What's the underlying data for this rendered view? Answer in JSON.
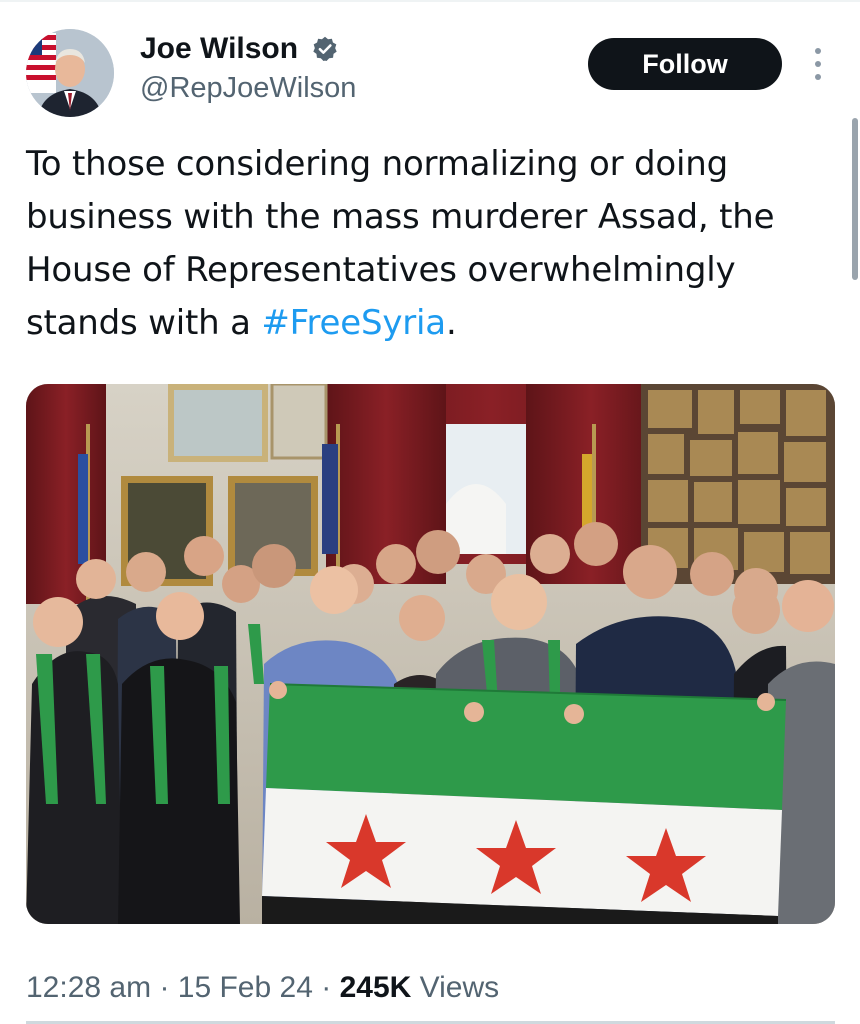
{
  "author": {
    "display_name": "Joe Wilson",
    "handle": "@RepJoeWilson",
    "verified_icon": "verified-badge-icon",
    "verified_color": "#536471"
  },
  "actions": {
    "follow_label": "Follow",
    "more_icon": "more-vertical-icon"
  },
  "tweet": {
    "text_before": "To those considering normalizing or doing business with the mass murderer Assad, the House of Representatives overwhelmingly stands with a ",
    "hashtag": "#FreeSyria",
    "text_after": ".",
    "hashtag_color": "#1d9bf0"
  },
  "media": {
    "type": "photo",
    "flag_colors": {
      "green": "#2e9a4a",
      "white": "#f4f4f2",
      "black": "#1a1a1a",
      "star": "#d9382b"
    }
  },
  "meta": {
    "time": "12:28 am",
    "separator": "·",
    "date": "15 Feb 24",
    "views_count": "245K",
    "views_label": "Views"
  },
  "colors": {
    "text_primary": "#0f1419",
    "text_secondary": "#536471",
    "button_bg": "#0f1419"
  }
}
